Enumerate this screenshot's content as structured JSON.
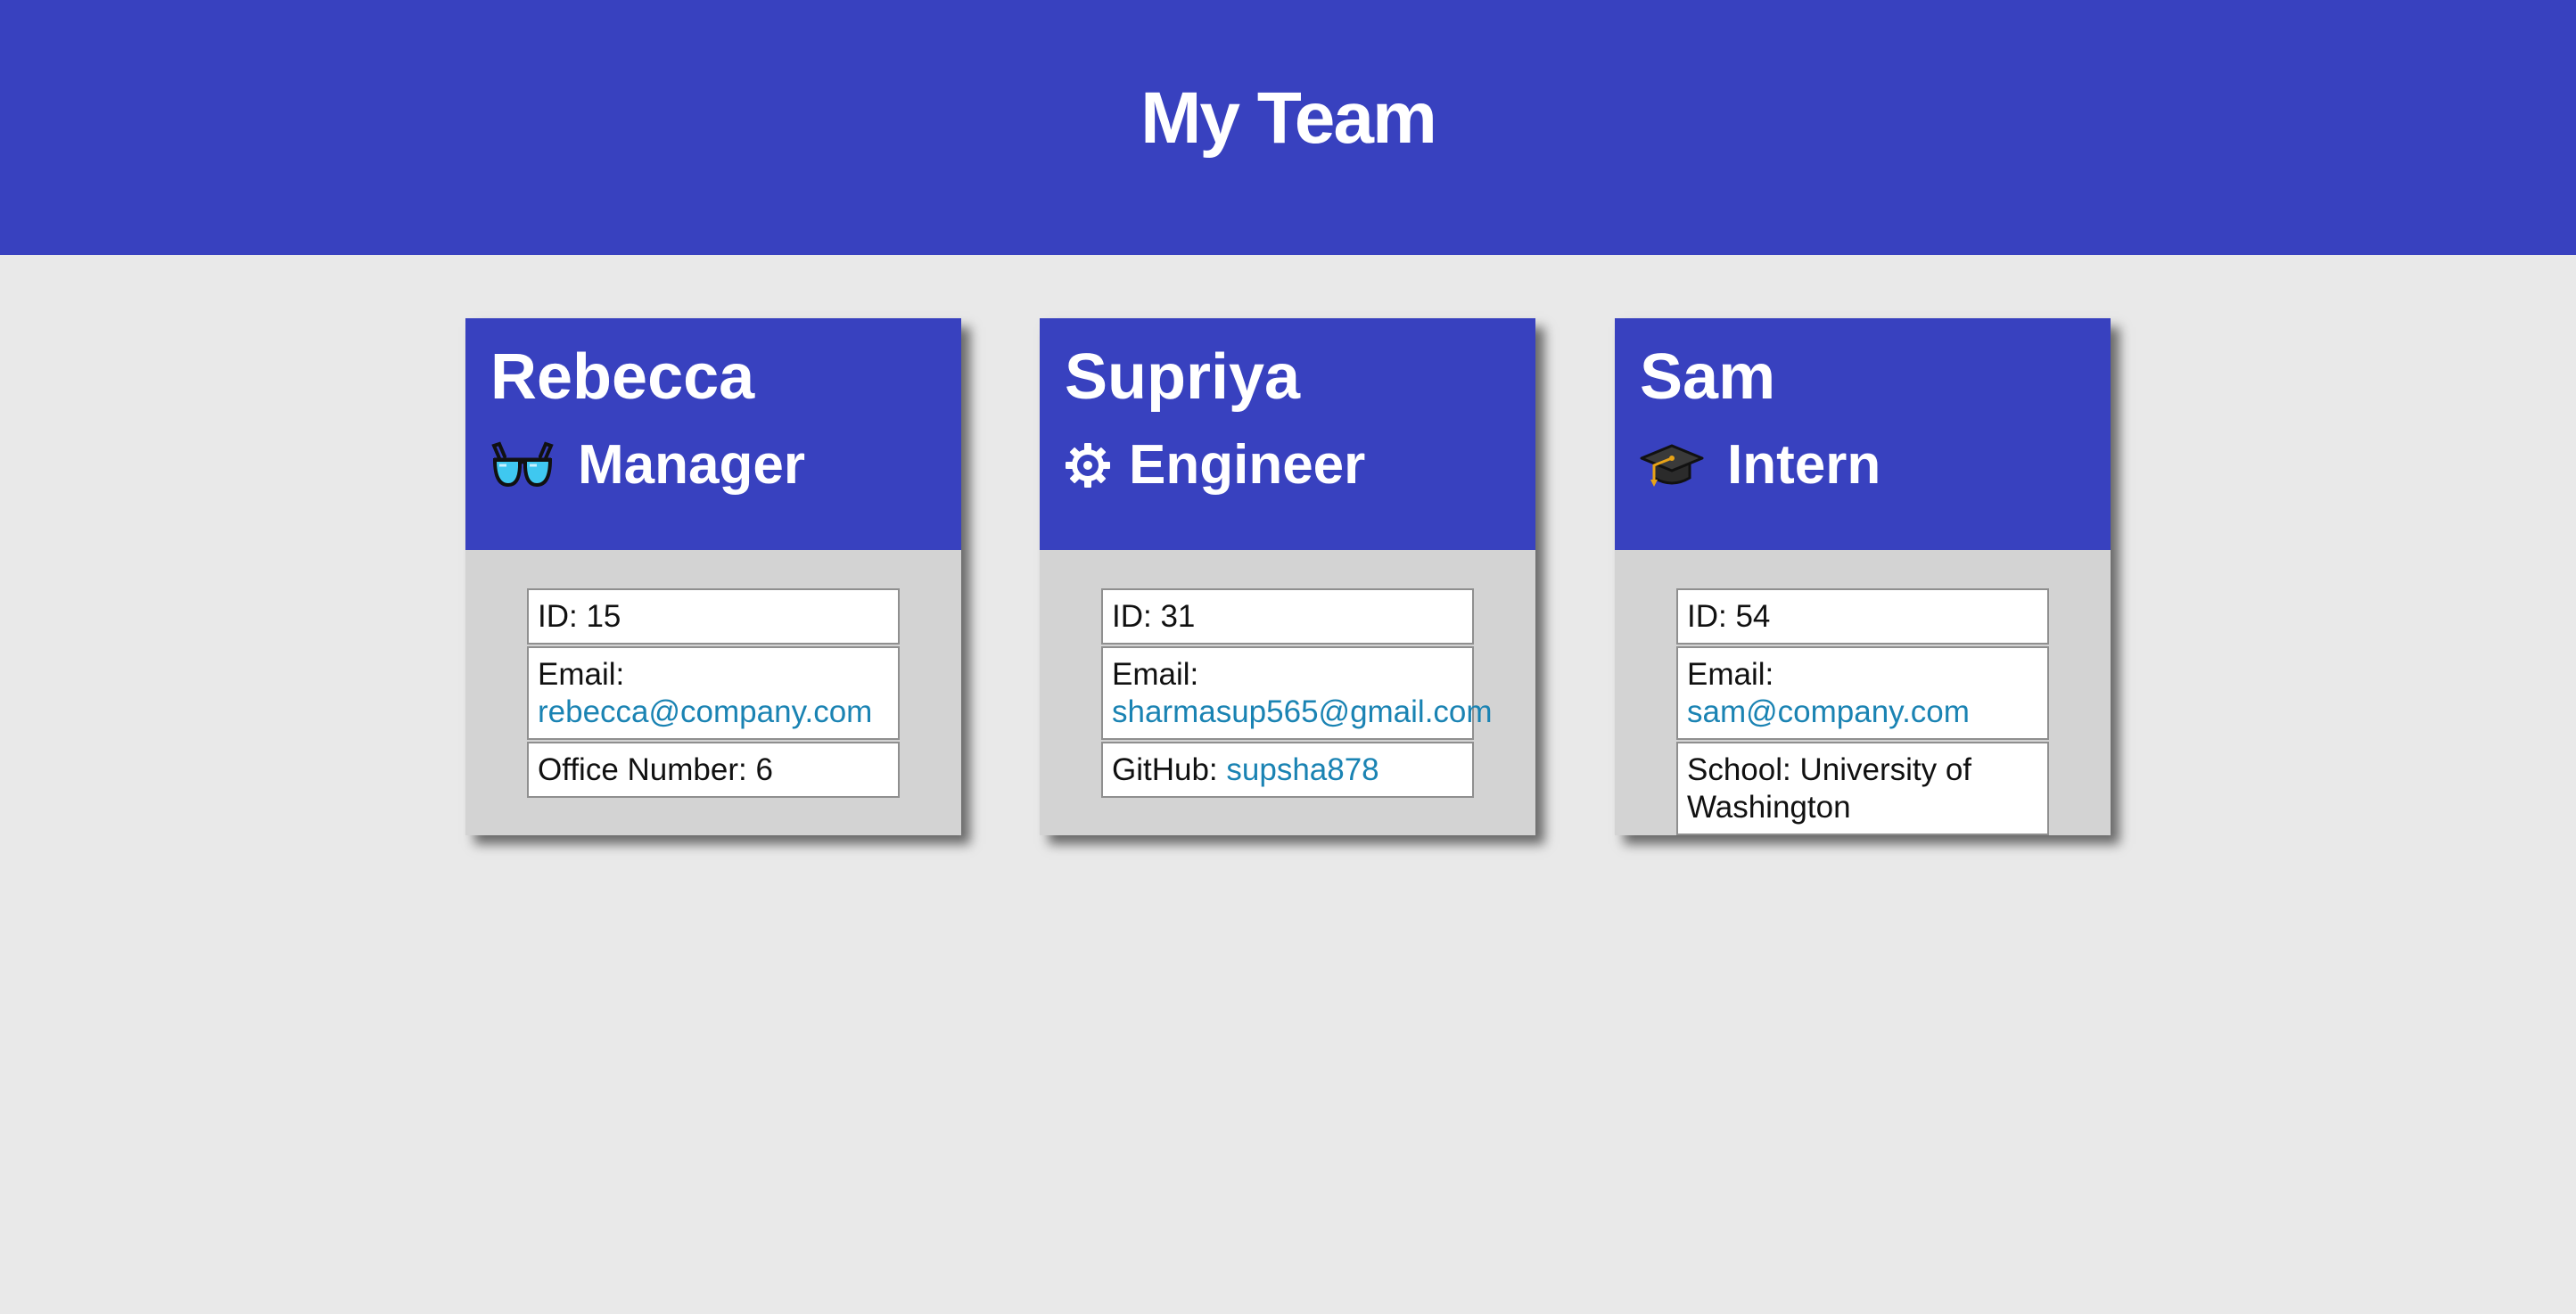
{
  "page": {
    "title": "My Team"
  },
  "colors": {
    "primary": "#3841bf",
    "background": "#e9e9e9",
    "card_body": "#d3d3d3",
    "link": "#1a83b3"
  },
  "team": [
    {
      "name": "Rebecca",
      "role": "Manager",
      "role_icon": "glasses-icon",
      "id_label": "ID:",
      "id_value": "15",
      "email_label": "Email:",
      "email_value": "rebecca@company.com",
      "extra_label": "Office Number:",
      "extra_value": "6"
    },
    {
      "name": "Supriya",
      "role": "Engineer",
      "role_icon": "gear-icon",
      "id_label": "ID:",
      "id_value": "31",
      "email_label": "Email:",
      "email_value": "sharmasup565@gmail.com",
      "extra_label": "GitHub:",
      "extra_value": "supsha878"
    },
    {
      "name": "Sam",
      "role": "Intern",
      "role_icon": "graduation-cap-icon",
      "id_label": "ID:",
      "id_value": "54",
      "email_label": "Email:",
      "email_value": "sam@company.com",
      "extra_label": "School:",
      "extra_value": "University of Washington"
    }
  ]
}
